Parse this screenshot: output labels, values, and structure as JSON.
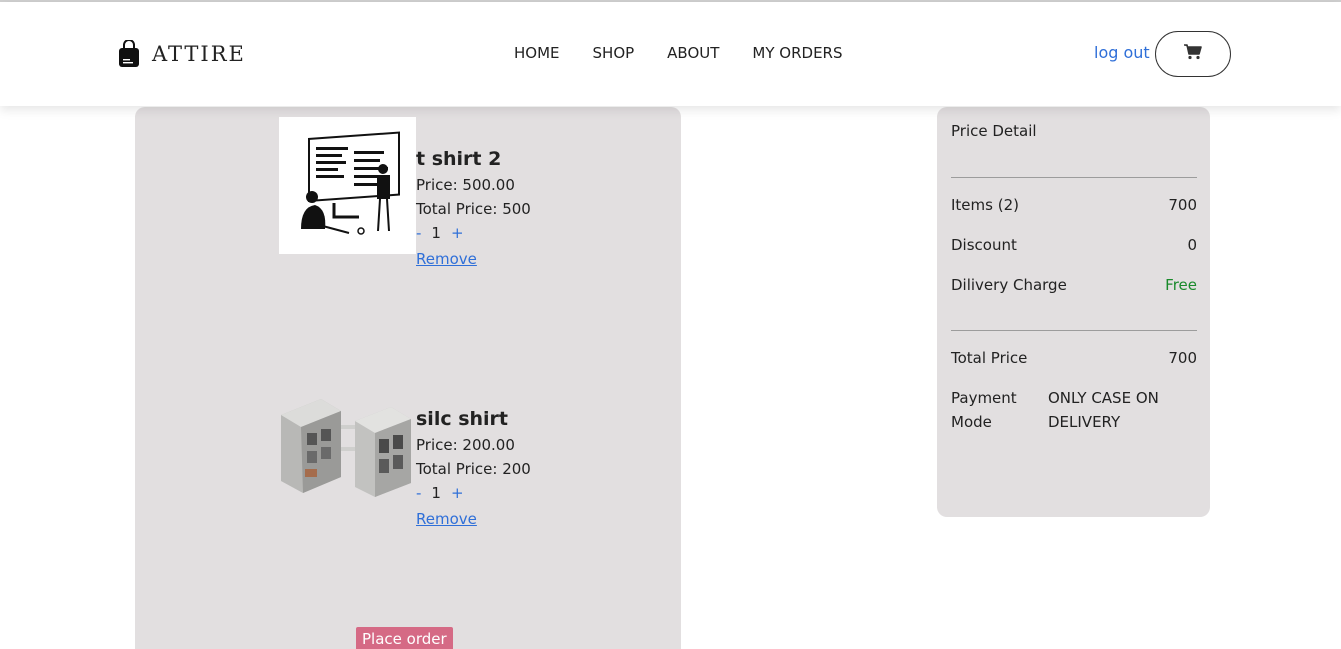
{
  "brand": {
    "name": "ATTIRE",
    "icon": "shopping-bag-icon"
  },
  "nav": {
    "links": [
      "HOME",
      "SHOP",
      "ABOUT",
      "MY ORDERS"
    ],
    "logout": "log out",
    "cart_icon": "cart-icon"
  },
  "cart": {
    "items": [
      {
        "name": "t shirt 2",
        "price": "Price: 500.00",
        "total": "Total Price: 500",
        "minus": "-",
        "qty": "1",
        "plus": "+",
        "remove": "Remove"
      },
      {
        "name": "silc shirt",
        "price": "Price: 200.00",
        "total": "Total Price: 200",
        "minus": "-",
        "qty": "1",
        "plus": "+",
        "remove": "Remove"
      }
    ],
    "place_order": "Place order"
  },
  "price_detail": {
    "title": "Price Detail",
    "items_label": "Items (2)",
    "items_value": "700",
    "discount_label": "Discount",
    "discount_value": "0",
    "delivery_label": "Dilivery Charge",
    "delivery_value": "Free",
    "total_label": "Total Price",
    "total_value": "700",
    "payment_label": "Payment Mode",
    "payment_value": "ONLY CASE ON DELIVERY"
  },
  "colors": {
    "accent": "#2f6fd8",
    "panel": "#e2dfe0",
    "place_order": "#d56a85",
    "free": "#198a2b"
  }
}
